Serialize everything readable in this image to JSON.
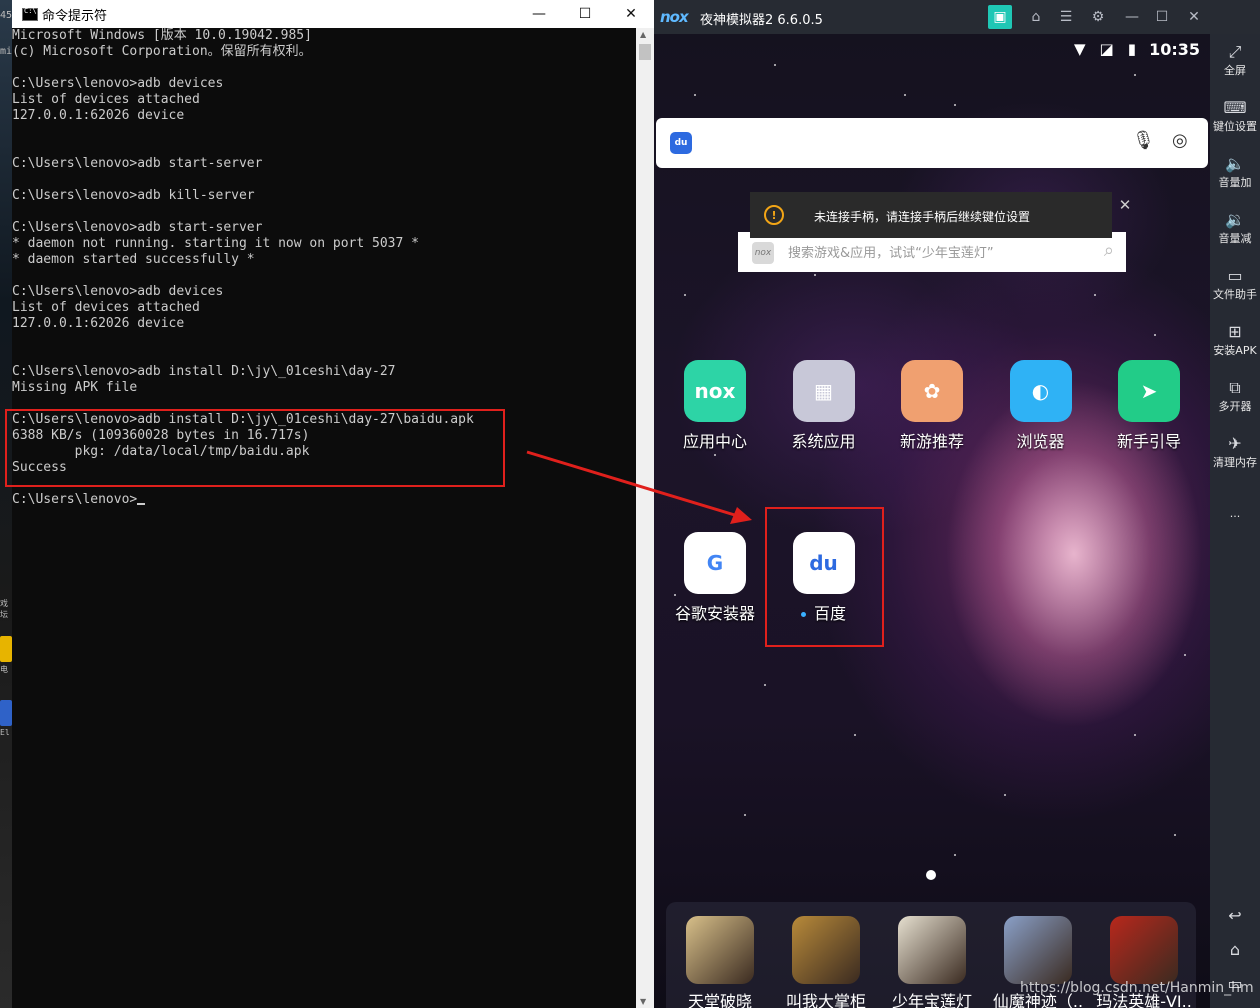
{
  "cmd": {
    "title": "命令提示符",
    "lines": [
      "Microsoft Windows [版本 10.0.19042.985]",
      "(c) Microsoft Corporation。保留所有权利。",
      "",
      "C:\\Users\\lenovo>adb devices",
      "List of devices attached",
      "127.0.0.1:62026 device",
      "",
      "",
      "C:\\Users\\lenovo>adb start-server",
      "",
      "C:\\Users\\lenovo>adb kill-server",
      "",
      "C:\\Users\\lenovo>adb start-server",
      "* daemon not running. starting it now on port 5037 *",
      "* daemon started successfully *",
      "",
      "C:\\Users\\lenovo>adb devices",
      "List of devices attached",
      "127.0.0.1:62026 device",
      "",
      "",
      "C:\\Users\\lenovo>adb install D:\\jy\\_01ceshi\\day-27",
      "Missing APK file",
      "",
      "C:\\Users\\lenovo>adb install D:\\jy\\_01ceshi\\day-27\\baidu.apk",
      "6388 KB/s (109360028 bytes in 16.717s)",
      "        pkg: /data/local/tmp/baidu.apk",
      "Success",
      "",
      "C:\\Users\\lenovo>"
    ],
    "buttons": {
      "minimize": "—",
      "maximize": "☐",
      "close": "✕"
    }
  },
  "desktop_strip": {
    "top": "45",
    "mid": "mi",
    "lower": "戏坛",
    "label2": "电",
    "label3": "El"
  },
  "nox": {
    "logo": "nox",
    "title": "夜神模拟器2 6.6.0.5",
    "clock": "10:35",
    "search_badge": "du",
    "toast": {
      "text": "未连接手柄，请连接手柄后继续键位设置"
    },
    "search2": {
      "logo": "nox",
      "placeholder": "搜索游戏&应用，试试“少年宝莲灯”"
    },
    "apps_row1": [
      {
        "label": "应用中心",
        "glyph": "nox",
        "color": "#2dd4a6"
      },
      {
        "label": "系统应用",
        "glyph": "▦",
        "color": "#c8c8d8"
      },
      {
        "label": "新游推荐",
        "glyph": "✿",
        "color": "#f0a070"
      },
      {
        "label": "浏览器",
        "glyph": "◐",
        "color": "#2fb2f5"
      },
      {
        "label": "新手引导",
        "glyph": "➤",
        "color": "#22cc88"
      }
    ],
    "apps_row2": [
      {
        "label": "谷歌安装器",
        "glyph": "G",
        "color": "#ffffff"
      },
      {
        "label": "百度",
        "glyph": "du",
        "color": "#ffffff"
      }
    ],
    "dock": [
      {
        "label": "天堂破晓",
        "color": "#d8c08a"
      },
      {
        "label": "叫我大掌柜",
        "color": "#b88a3a"
      },
      {
        "label": "少年宝莲灯",
        "color": "#e6e0d0"
      },
      {
        "label": "仙魔神迹（..",
        "color": "#8aa0c8"
      },
      {
        "label": "玛法英雄-VI..",
        "color": "#b8281c"
      }
    ],
    "sidebar": [
      {
        "label": "全屏",
        "icon": "⤢"
      },
      {
        "label": "键位设置",
        "icon": "⌨"
      },
      {
        "label": "音量加",
        "icon": "🔈"
      },
      {
        "label": "音量减",
        "icon": "🔉"
      },
      {
        "label": "文件助手",
        "icon": "▭"
      },
      {
        "label": "安装APK",
        "icon": "⊞"
      },
      {
        "label": "多开器",
        "icon": "⧉"
      },
      {
        "label": "清理内存",
        "icon": "✈"
      },
      {
        "label": "···",
        "icon": ""
      }
    ],
    "nav": {
      "back": "↩",
      "home": "⌂",
      "recent": "▭"
    }
  },
  "watermark": "https://blog.csdn.net/Hanmin_hm"
}
